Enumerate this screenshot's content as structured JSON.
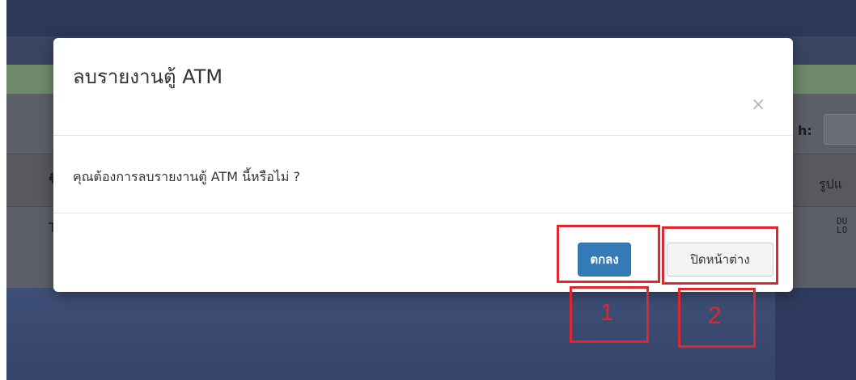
{
  "background": {
    "search_label": "h:",
    "column_left_header": "ชื",
    "column_right_header": "รูปแ",
    "row_left_text": "T",
    "row_right_text": "DU LO"
  },
  "modal": {
    "title": "ลบรายงานตู้ ATM",
    "close_symbol": "×",
    "message": "คุณต้องการลบรายงานตู้ ATM นี้หรือไม่ ?",
    "ok_label": "ตกลง",
    "close_label": "ปิดหน้าต่าง"
  },
  "annotations": {
    "label_1": "1",
    "label_2": "2",
    "color": "#e0272d"
  },
  "colors": {
    "primary_button": "#337ab7",
    "default_button": "#f4f4f4"
  }
}
